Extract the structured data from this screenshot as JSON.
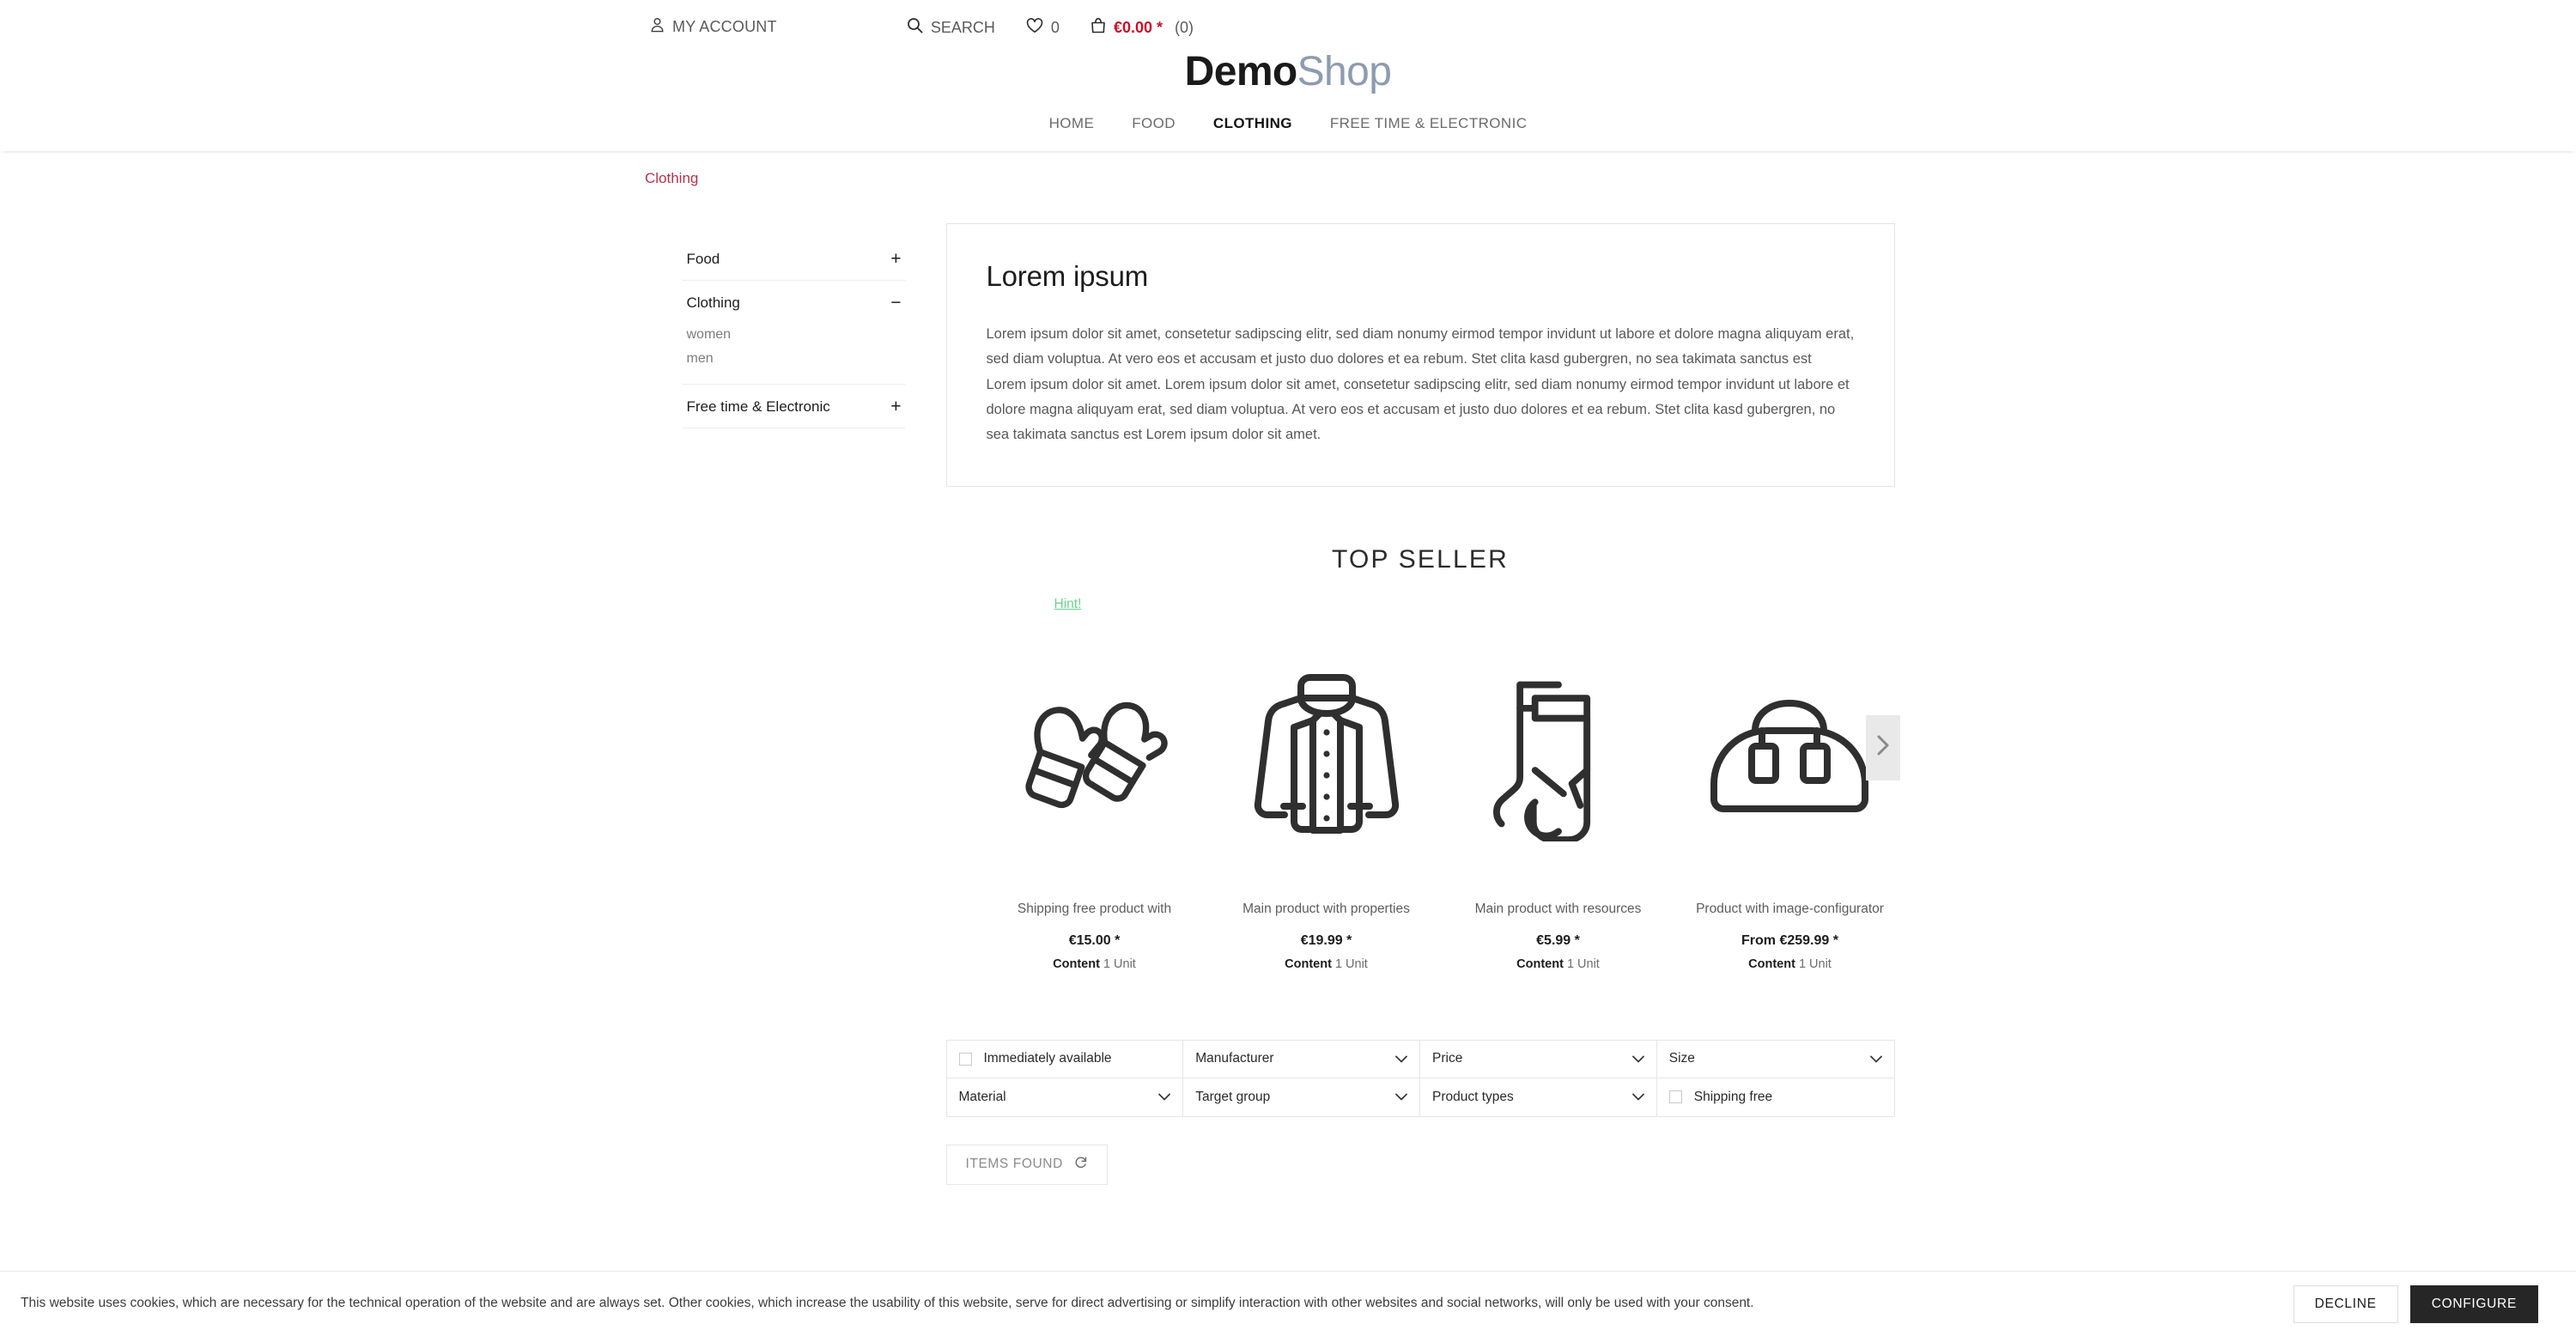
{
  "header": {
    "account_label": "MY ACCOUNT",
    "account_icon": "user-icon",
    "search_label": "SEARCH",
    "search_icon": "search-icon",
    "wishlist_icon": "heart-icon",
    "wishlist_count": "0",
    "cart_icon": "bag-icon",
    "cart_amount": "€0.00 *",
    "cart_count": "(0)",
    "logo_bold": "Demo",
    "logo_light": "Shop",
    "accent_color": "#c9112a",
    "nav": [
      {
        "label": "HOME",
        "active": false
      },
      {
        "label": "FOOD",
        "active": false
      },
      {
        "label": "CLOTHING",
        "active": true
      },
      {
        "label": "FREE TIME & ELECTRONIC",
        "active": false
      }
    ]
  },
  "breadcrumb": {
    "label": "Clothing",
    "color": "#b3334a"
  },
  "sidebar": {
    "blocks": [
      {
        "title": "Food",
        "toggle": "+",
        "expanded": false,
        "children": []
      },
      {
        "title": "Clothing",
        "toggle": "−",
        "expanded": true,
        "children": [
          "women",
          "men"
        ]
      },
      {
        "title": "Free time & Electronic",
        "toggle": "+",
        "expanded": false,
        "children": []
      }
    ]
  },
  "main": {
    "panel": {
      "heading": "Lorem ipsum",
      "body": "Lorem ipsum dolor sit amet, consetetur sadipscing elitr, sed diam nonumy eirmod tempor invidunt ut labore et dolore magna aliquyam erat, sed diam voluptua. At vero eos et accusam et justo duo dolores et ea rebum. Stet clita kasd gubergren, no sea takimata sanctus est Lorem ipsum dolor sit amet. Lorem ipsum dolor sit amet, consetetur sadipscing elitr, sed diam nonumy eirmod tempor invidunt ut labore et dolore magna aliquyam erat, sed diam voluptua. At vero eos et accusam et justo duo dolores et ea rebum. Stet clita kasd gubergren, no sea takimata sanctus est Lorem ipsum dolor sit amet."
    },
    "section_title": "TOP SELLER",
    "hint_label": "Hint!",
    "hint_color": "#6ad18e",
    "slider_next_icon": "chevron-right-icon",
    "products": [
      {
        "icon": "mittens-icon",
        "name": "Shipping free product with",
        "price": "€15.00 *",
        "content_label": "Content",
        "content_value": "1 Unit"
      },
      {
        "icon": "jacket-icon",
        "name": "Main product with properties",
        "price": "€19.99 *",
        "content_label": "Content",
        "content_value": "1 Unit"
      },
      {
        "icon": "socks-icon",
        "name": "Main product with resources",
        "price": "€5.99 *",
        "content_label": "Content",
        "content_value": "1 Unit"
      },
      {
        "icon": "duffel-bag-icon",
        "name": "Product with image-configurator",
        "price": "From €259.99 *",
        "content_label": "Content",
        "content_value": "1 Unit"
      }
    ],
    "filters": [
      {
        "label": "Immediately available",
        "type": "checkbox",
        "checked": false
      },
      {
        "label": "Manufacturer",
        "type": "select"
      },
      {
        "label": "Price",
        "type": "select"
      },
      {
        "label": "Size",
        "type": "select"
      },
      {
        "label": "Material",
        "type": "select"
      },
      {
        "label": "Target group",
        "type": "select"
      },
      {
        "label": "Product types",
        "type": "select"
      },
      {
        "label": "Shipping free",
        "type": "checkbox",
        "checked": false
      }
    ],
    "items_found_label": "ITEMS FOUND",
    "items_found_icon": "refresh-icon"
  },
  "cookiebar": {
    "text": "This website uses cookies, which are necessary for the technical operation of the website and are always set. Other cookies, which increase the usability of this website, serve for direct advertising or simplify interaction with other websites and social networks, will only be used with your consent.",
    "decline_label": "DECLINE",
    "configure_label": "CONFIGURE"
  }
}
